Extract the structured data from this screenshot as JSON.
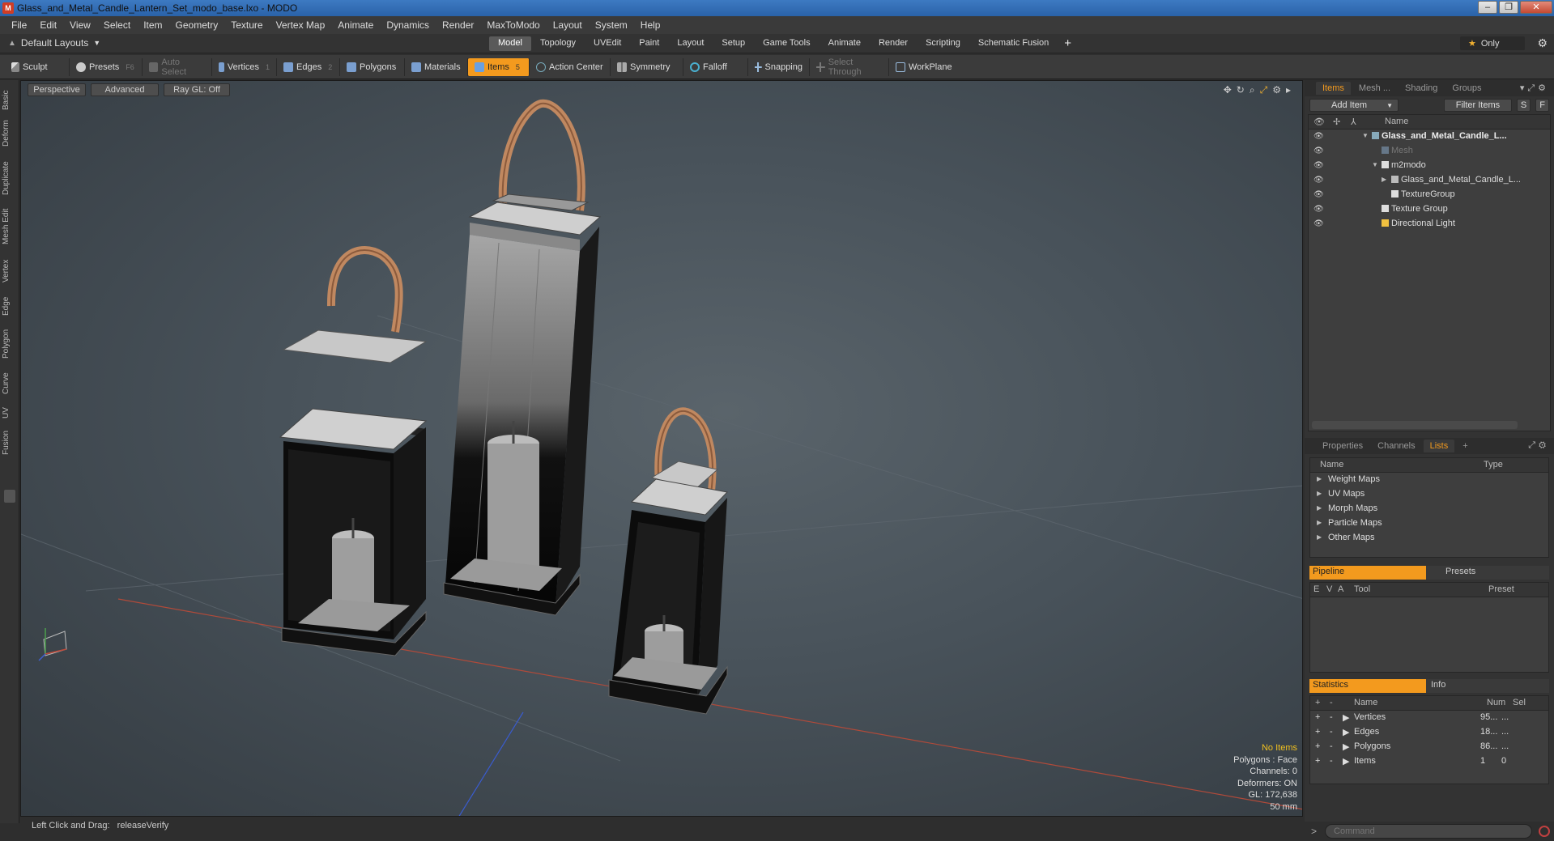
{
  "window": {
    "title": "Glass_and_Metal_Candle_Lantern_Set_modo_base.lxo - MODO",
    "app_icon": "modo-logo-icon"
  },
  "menu": [
    "File",
    "Edit",
    "View",
    "Select",
    "Item",
    "Geometry",
    "Texture",
    "Vertex Map",
    "Animate",
    "Dynamics",
    "Render",
    "MaxToModo",
    "Layout",
    "System",
    "Help"
  ],
  "layout_bar": {
    "layout_selector": "Default Layouts",
    "tabs": [
      "Model",
      "Topology",
      "UVEdit",
      "Paint",
      "Layout",
      "Setup",
      "Game Tools",
      "Animate",
      "Render",
      "Scripting",
      "Schematic Fusion"
    ],
    "active_tab": "Model",
    "add_tab": "+",
    "only_label": "Only"
  },
  "toolbar": {
    "sculpt": "Sculpt",
    "presets": "Presets",
    "presets_key": "F6",
    "auto_select": "Auto Select",
    "vertices": "Vertices",
    "vertices_num": "1",
    "edges": "Edges",
    "edges_num": "2",
    "polygons": "Polygons",
    "materials": "Materials",
    "items": "Items",
    "items_num": "5",
    "action_center": "Action Center",
    "symmetry": "Symmetry",
    "falloff": "Falloff",
    "snapping": "Snapping",
    "select_through": "Select Through",
    "workplane": "WorkPlane"
  },
  "left_tabs": [
    "Basic",
    "Deform",
    "Duplicate",
    "Mesh Edit",
    "Vertex",
    "Edge",
    "Polygon",
    "Curve",
    "UV",
    "Fusion"
  ],
  "viewport": {
    "view_mode": "Perspective",
    "shading": "Advanced",
    "raygl": "Ray GL: Off",
    "info": {
      "selection": "No Items",
      "polygons": "Polygons : Face",
      "channels": "Channels: 0",
      "deformers": "Deformers: ON",
      "gl": "GL: 172,638",
      "scale": "50 mm"
    }
  },
  "status": {
    "hint": "Left Click and Drag:",
    "action": "releaseVerify"
  },
  "items_panel": {
    "tabs": [
      "Items",
      "Mesh ...",
      "Shading",
      "Groups"
    ],
    "active_tab": "Items",
    "add_item": "Add Item",
    "filter_items": "Filter Items",
    "s_btn": "S",
    "f_btn": "F",
    "name_header": "Name",
    "tree": [
      {
        "label": "Glass_and_Metal_Candle_L...",
        "level": 0,
        "bold": true,
        "dim": false,
        "expanded": "▼",
        "icon": "scene-icon"
      },
      {
        "label": "Mesh",
        "level": 1,
        "bold": false,
        "dim": true,
        "expanded": "",
        "icon": "mesh-icon"
      },
      {
        "label": "m2modo",
        "level": 1,
        "bold": false,
        "dim": false,
        "expanded": "▼",
        "icon": "locator-icon"
      },
      {
        "label": "Glass_and_Metal_Candle_L...",
        "level": 2,
        "bold": false,
        "dim": false,
        "expanded": "▶",
        "icon": "group-icon"
      },
      {
        "label": "TextureGroup",
        "level": 2,
        "bold": false,
        "dim": false,
        "expanded": "",
        "icon": "locator-icon"
      },
      {
        "label": "Texture Group",
        "level": 1,
        "bold": false,
        "dim": false,
        "expanded": "",
        "icon": "locator-icon"
      },
      {
        "label": "Directional Light",
        "level": 1,
        "bold": false,
        "dim": false,
        "expanded": "",
        "icon": "light-icon"
      }
    ]
  },
  "properties_panel": {
    "tabs": [
      "Properties",
      "Channels",
      "Lists"
    ],
    "active_tab": "Lists",
    "add_tab": "+",
    "headers": {
      "name": "Name",
      "type": "Type"
    },
    "rows": [
      "Weight Maps",
      "UV Maps",
      "Morph Maps",
      "Particle Maps",
      "Other Maps"
    ]
  },
  "pipeline_panel": {
    "tabs": [
      "Pipeline",
      "Presets"
    ],
    "headers": {
      "e": "E",
      "v": "V",
      "a": "A",
      "tool": "Tool",
      "preset": "Preset"
    }
  },
  "statistics_panel": {
    "tabs": [
      "Statistics",
      "Info"
    ],
    "headers": {
      "plus": "+",
      "minus": "-",
      "name": "Name",
      "num": "Num",
      "sel": "Sel"
    },
    "rows": [
      {
        "name": "Vertices",
        "num": "95...",
        "sel": "..."
      },
      {
        "name": "Edges",
        "num": "18...",
        "sel": "..."
      },
      {
        "name": "Polygons",
        "num": "86...",
        "sel": "..."
      },
      {
        "name": "Items",
        "num": "1",
        "sel": "0"
      }
    ]
  },
  "command": {
    "prompt": ">",
    "placeholder": "Command"
  },
  "colors": {
    "accent": "#f39a1e",
    "title_bar": "#2a62a8",
    "handle": "#c08860",
    "lantern_frame": "#0f0f0f"
  }
}
